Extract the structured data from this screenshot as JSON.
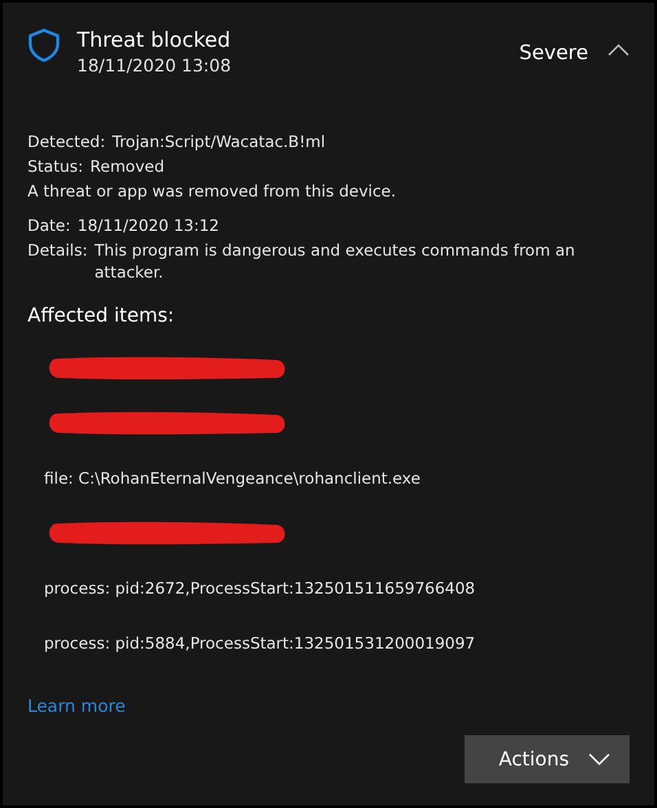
{
  "header": {
    "title": "Threat blocked",
    "timestamp": "18/11/2020 13:08",
    "severity": "Severe",
    "expanded": true
  },
  "summary": [
    {
      "label": "Detected:",
      "value": "Trojan:Script/Wacatac.B!ml"
    },
    {
      "label": "Status:",
      "value": "Removed"
    }
  ],
  "message": "A threat or app was removed from this device.",
  "details": [
    {
      "label": "Date:",
      "value": "18/11/2020 13:12"
    },
    {
      "label": "Details:",
      "value": "This program is dangerous and executes commands from an attacker."
    }
  ],
  "affected_items": {
    "heading": "Affected items:",
    "items": [
      {
        "kind": "redacted"
      },
      {
        "kind": "redacted"
      },
      {
        "kind": "text",
        "text": "file: C:\\RohanEternalVengeance\\rohanclient.exe"
      },
      {
        "kind": "redacted"
      },
      {
        "kind": "text",
        "text": "process: pid:2672,ProcessStart:132501511659766408"
      },
      {
        "kind": "text",
        "text": "process: pid:5884,ProcessStart:132501531200019097"
      }
    ]
  },
  "link": "Learn more",
  "actions_button": "Actions"
}
